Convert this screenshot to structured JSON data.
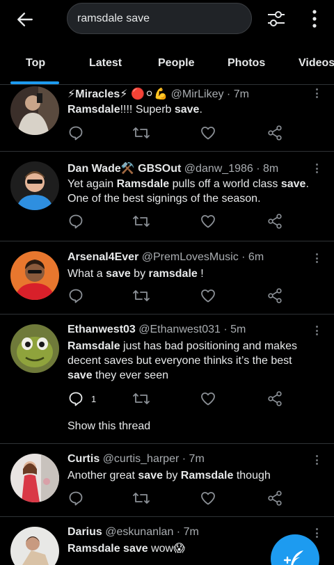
{
  "search": {
    "query": "ramsdale save"
  },
  "tabs": [
    "Top",
    "Latest",
    "People",
    "Photos",
    "Videos"
  ],
  "active_tab": "Top",
  "colors": {
    "accent": "#1d9bf0",
    "background": "#000000",
    "text": "#e7e9ea",
    "muted": "#71767b"
  },
  "tweets": [
    {
      "name": "⚡Miracles⚡ 🔴⚪💪",
      "handle": "@MirLikey",
      "time": "· 7m",
      "text": [
        {
          "t": "Ramsdale",
          "b": true
        },
        {
          "t": "!!!! Superb ",
          "b": false
        },
        {
          "t": "save",
          "b": true
        },
        {
          "t": ".",
          "b": false
        }
      ],
      "replies": ""
    },
    {
      "name": "Dan Wade⚒️ GBSOut",
      "handle": "@danw_1986",
      "time": "· 8m",
      "text": [
        {
          "t": "Yet again ",
          "b": false
        },
        {
          "t": "Ramsdale",
          "b": true
        },
        {
          "t": " pulls off a world class ",
          "b": false
        },
        {
          "t": "save",
          "b": true
        },
        {
          "t": ". One of the best signings of the season.",
          "b": false
        }
      ],
      "replies": ""
    },
    {
      "name": "Arsenal4Ever",
      "handle": "@PremLovesMusic",
      "time": "· 6m",
      "text": [
        {
          "t": "What a ",
          "b": false
        },
        {
          "t": "save",
          "b": true
        },
        {
          "t": " by ",
          "b": false
        },
        {
          "t": "ramsdale",
          "b": true
        },
        {
          "t": " !",
          "b": false
        }
      ],
      "replies": ""
    },
    {
      "name": "Ethanwest03",
      "handle": "@Ethanwest031",
      "time": "· 5m",
      "text": [
        {
          "t": "Ramsdale",
          "b": true
        },
        {
          "t": " just has bad positioning and makes decent saves but everyone thinks it’s the best ",
          "b": false
        },
        {
          "t": "save",
          "b": true
        },
        {
          "t": " they ever seen",
          "b": false
        }
      ],
      "replies": "1",
      "show_thread": "Show this thread"
    },
    {
      "name": "Curtis",
      "handle": "@curtis_harper",
      "time": "· 7m",
      "text": [
        {
          "t": "Another great ",
          "b": false
        },
        {
          "t": "save",
          "b": true
        },
        {
          "t": " by ",
          "b": false
        },
        {
          "t": "Ramsdale",
          "b": true
        },
        {
          "t": " though",
          "b": false
        }
      ],
      "replies": ""
    },
    {
      "name": "Darius",
      "handle": "@eskunanlan",
      "time": "· 7m",
      "text": [
        {
          "t": "Ramsdale save",
          "b": true
        },
        {
          "t": " wow😱",
          "b": false
        }
      ],
      "replies": ""
    }
  ],
  "icons": {
    "back": "arrow-left-icon",
    "filter": "sliders-icon",
    "more": "more-vertical-icon",
    "reply": "reply-icon",
    "retweet": "retweet-icon",
    "like": "heart-icon",
    "share": "share-icon",
    "compose": "compose-icon"
  }
}
